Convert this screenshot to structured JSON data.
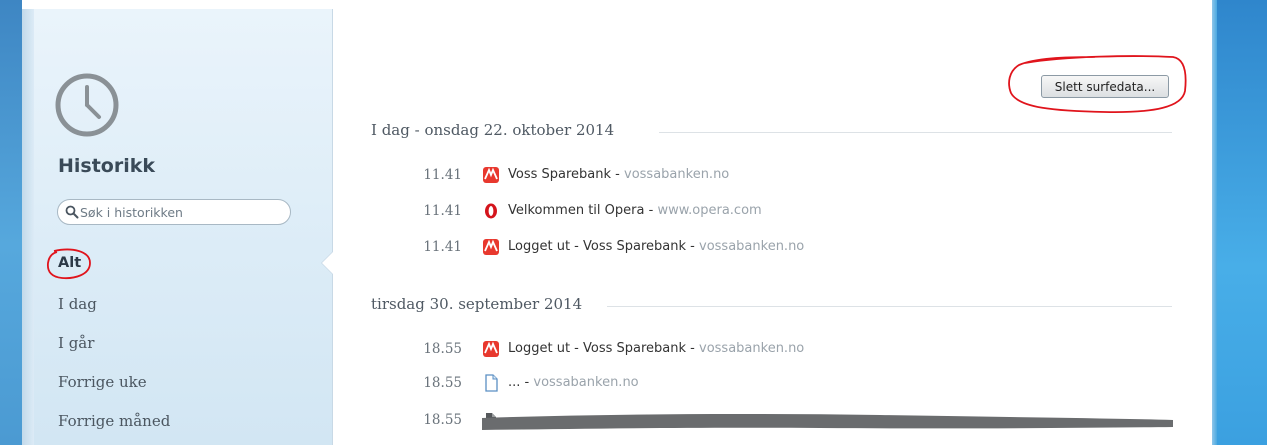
{
  "sidebar": {
    "title": "Historikk",
    "search": {
      "placeholder": "Søk i historikken",
      "value": ""
    },
    "nav": [
      {
        "label": "Alt",
        "active": true
      },
      {
        "label": "I dag"
      },
      {
        "label": "I går"
      },
      {
        "label": "Forrige uke"
      },
      {
        "label": "Forrige måned"
      }
    ],
    "icon": "clock-icon"
  },
  "main": {
    "clear_button_label": "Slett surfedata...",
    "groups": [
      {
        "heading": "I dag - onsdag 22. oktober 2014",
        "items": [
          {
            "time": "11.41",
            "icon": "voss-sparebank-logo-icon",
            "title": "Voss Sparebank",
            "sep": "-",
            "domain": "vossabanken.no"
          },
          {
            "time": "11.41",
            "icon": "opera-logo-icon",
            "title": "Velkommen til Opera",
            "sep": "-",
            "domain": "www.opera.com"
          },
          {
            "time": "11.41",
            "icon": "voss-sparebank-logo-icon",
            "title": "Logget ut - Voss Sparebank",
            "sep": "-",
            "domain": "vossabanken.no"
          }
        ]
      },
      {
        "heading": "tirsdag 30. september 2014",
        "items": [
          {
            "time": "18.55",
            "icon": "voss-sparebank-logo-icon",
            "title": "Logget ut - Voss Sparebank",
            "sep": "-",
            "domain": "vossabanken.no"
          },
          {
            "time": "18.55",
            "icon": "blank-page-icon",
            "title": "...",
            "sep": "-",
            "domain": "vossabanken.no"
          },
          {
            "time": "18.55",
            "icon": "document-icon",
            "title": "",
            "sep": "",
            "domain": ""
          }
        ]
      }
    ]
  },
  "colors": {
    "annotation_red": "#e0141c",
    "frame_blue": "#48aee8",
    "sidebar_bg": "#dcecf7"
  }
}
